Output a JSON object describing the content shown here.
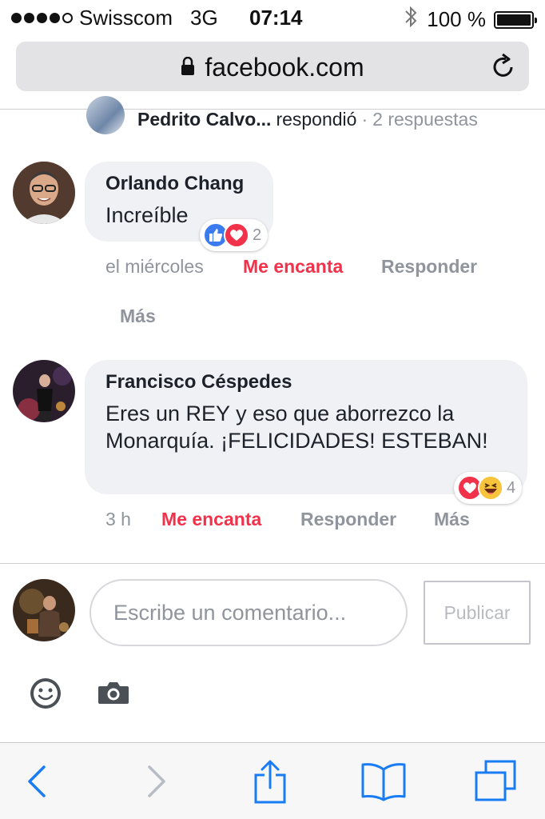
{
  "status_bar": {
    "carrier": "Swisscom",
    "network": "3G",
    "time": "07:14",
    "battery": "100 %"
  },
  "url_bar": {
    "domain": "facebook.com"
  },
  "reply_summary": {
    "author": "Pedrito Calvo...",
    "verb": "respondió",
    "separator": "·",
    "count": "2 respuestas"
  },
  "comments": [
    {
      "author": "Orlando Chang",
      "text": "Increíble",
      "reactions": [
        "like-icon",
        "love-icon"
      ],
      "reaction_count": "2",
      "time": "el miércoles",
      "reacted_label": "Me encanta",
      "reply_label": "Responder",
      "more_label": "Más"
    },
    {
      "author": "Francisco Céspedes",
      "text": "Eres un REY y eso que aborrezco la Monarquía. ¡FELICIDADES! ESTEBAN!",
      "reactions": [
        "love-icon",
        "haha-icon"
      ],
      "reaction_count": "4",
      "time": "3 h",
      "reacted_label": "Me encanta",
      "reply_label": "Responder",
      "more_label": "Más"
    }
  ],
  "composer": {
    "placeholder": "Escribe un comentario...",
    "publish_label": "Publicar",
    "icons": [
      "emoji-icon",
      "camera-icon"
    ]
  },
  "toolbar": {
    "icons": [
      "back-icon",
      "forward-icon",
      "share-icon",
      "bookmarks-icon",
      "tabs-icon"
    ]
  },
  "colors": {
    "accent_blue": "#3b7bf0",
    "love_red": "#f2314a",
    "bubble_bg": "#f0f1f4",
    "meta_gray": "#90949c",
    "ios_blue": "#1a7cf5"
  }
}
